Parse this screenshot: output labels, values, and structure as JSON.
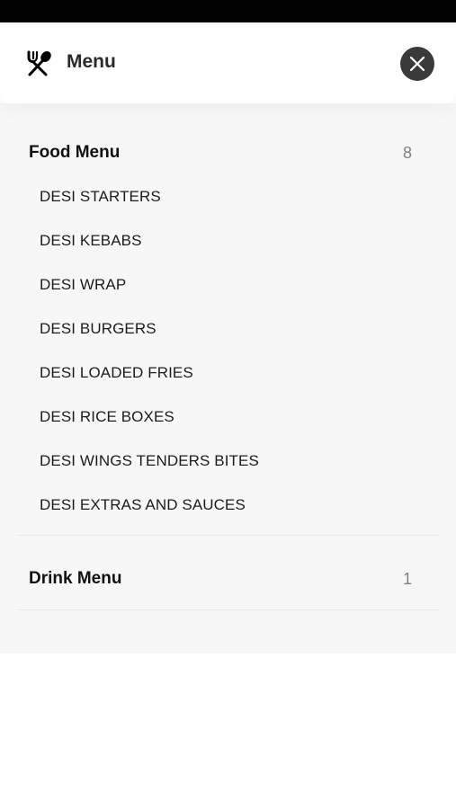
{
  "header": {
    "title": "Menu",
    "icon": "cutlery-icon",
    "close_icon": "close-icon"
  },
  "sections": [
    {
      "title": "Food Menu",
      "count": "8",
      "items": [
        "DESI STARTERS",
        "DESI KEBABS",
        "DESI WRAP",
        "DESI BURGERS",
        "DESI LOADED FRIES",
        "DESI RICE BOXES",
        "DESI WINGS TENDERS BITES",
        "DESI EXTRAS AND SAUCES"
      ]
    },
    {
      "title": "Drink Menu",
      "count": "1",
      "items": []
    }
  ],
  "colors": {
    "status_bar": "#000000",
    "panel_background": "#f7f7f7",
    "close_button": "#3a3a3a",
    "count_text": "#808080"
  }
}
